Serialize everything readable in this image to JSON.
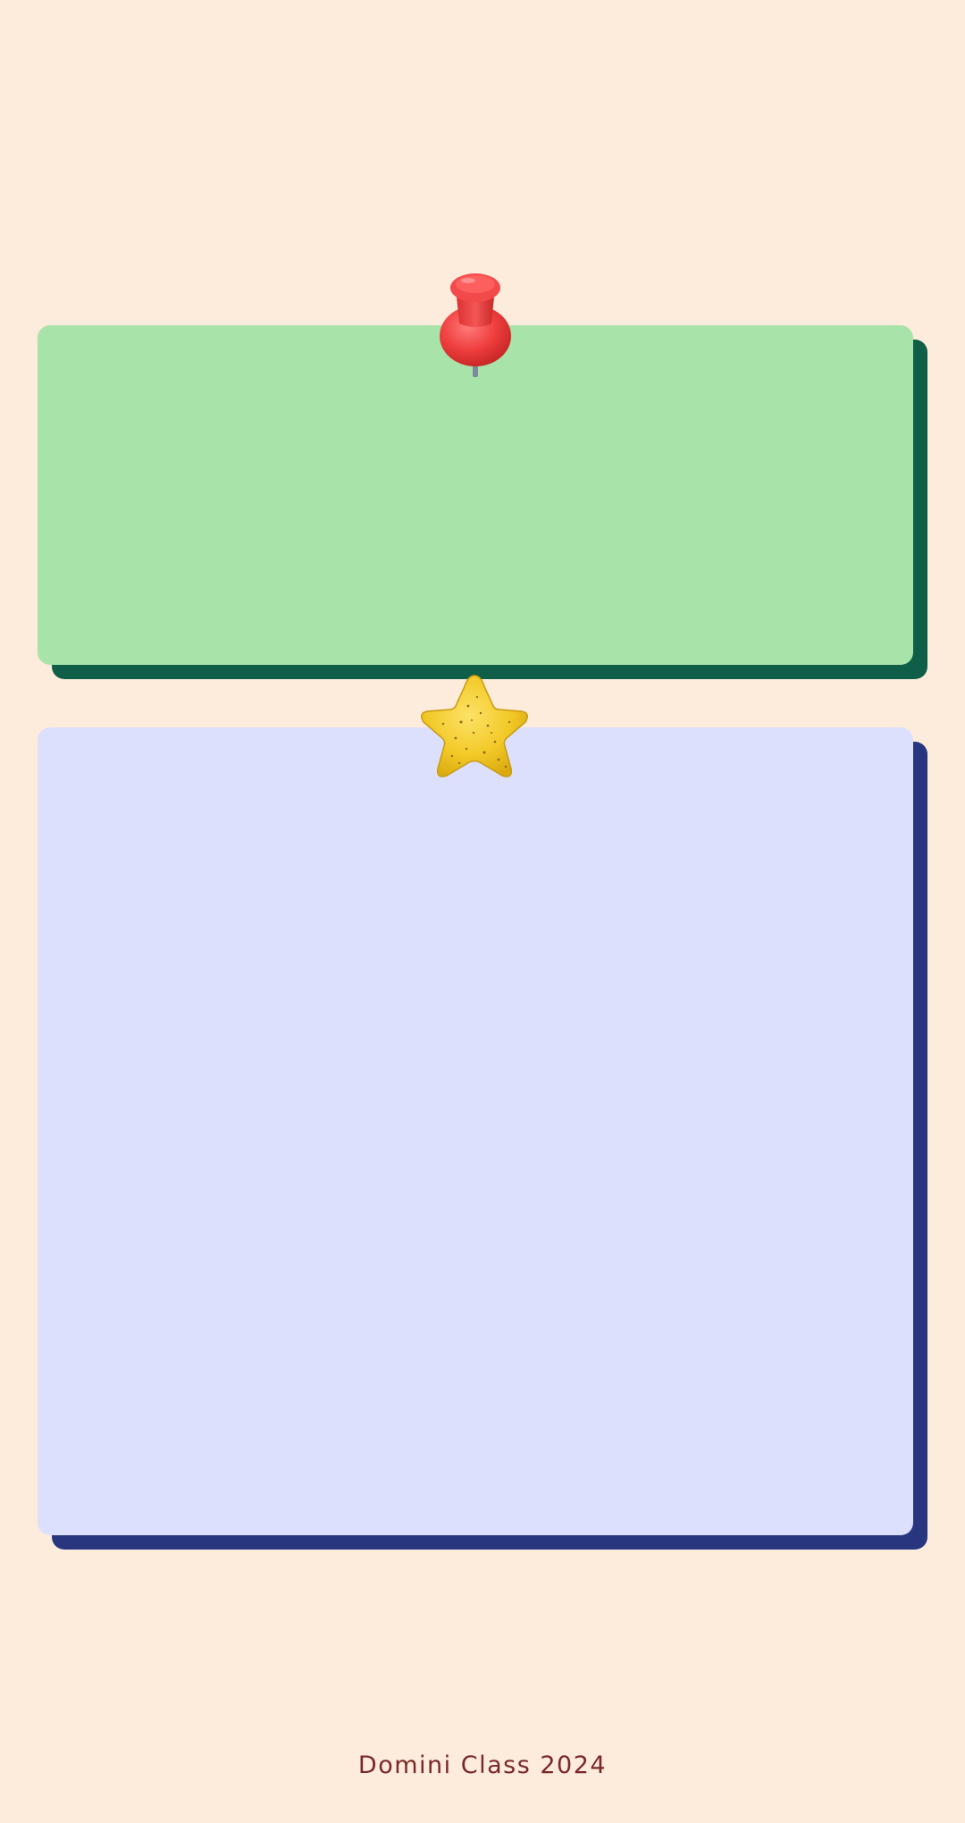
{
  "colors": {
    "background": "#FDECDC",
    "top_card": "#A8E3A9",
    "top_card_shadow": "#0F5E48",
    "bottom_card": "#DCE0FD",
    "bottom_card_shadow": "#27367F",
    "pin": "#EF3E3E",
    "star": "#F2C927",
    "footer_text": "#7A2828"
  },
  "icons": {
    "pin": "push-pin-icon",
    "star": "star-icon"
  },
  "footer": {
    "text": "Domini Class 2024"
  }
}
